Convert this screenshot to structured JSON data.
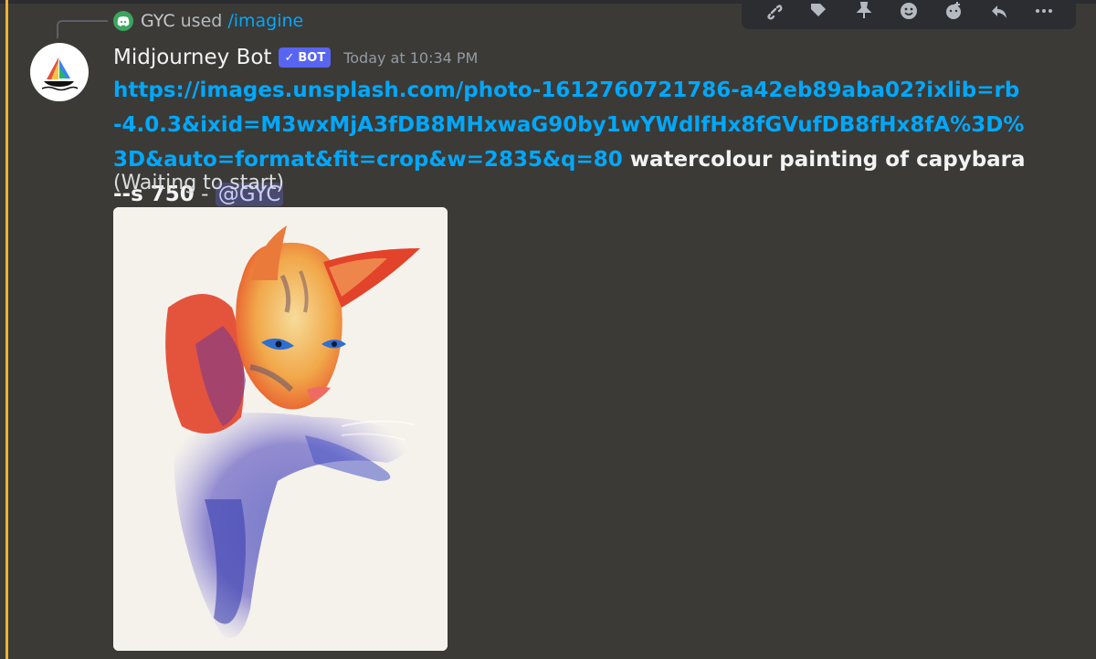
{
  "reply": {
    "user": "GYC",
    "used": "used",
    "command": "/imagine"
  },
  "message": {
    "author": "Midjourney Bot",
    "bot_tag": "BOT",
    "timestamp": "Today at 10:34 PM",
    "link_text": "https://images.unsplash.com/photo-1612760721786-a42eb89aba02?ixlib=rb-4.0.3&ixid=M3wxMjA3fDB8MHxwaG90by1wYWdlfHx8fGVufDB8fHx8fA%3D%3D&auto=format&fit=crop&w=2835&q=80",
    "prompt": " watercolour painting of capybara --s 750",
    "separator": " - ",
    "mention": "@GYC",
    "status": "(Waiting to start)"
  },
  "toolbar": {
    "icons": [
      "link-icon",
      "tag-icon",
      "pin-icon",
      "emoji-icon",
      "emoji-add-icon",
      "reply-icon",
      "more-icon"
    ]
  },
  "colors": {
    "background": "#3b3a36",
    "link": "#00a8fc",
    "bot_tag": "#5865f2",
    "mention_bar": "#f0b232",
    "mention_bg": "#4a4a6e"
  }
}
